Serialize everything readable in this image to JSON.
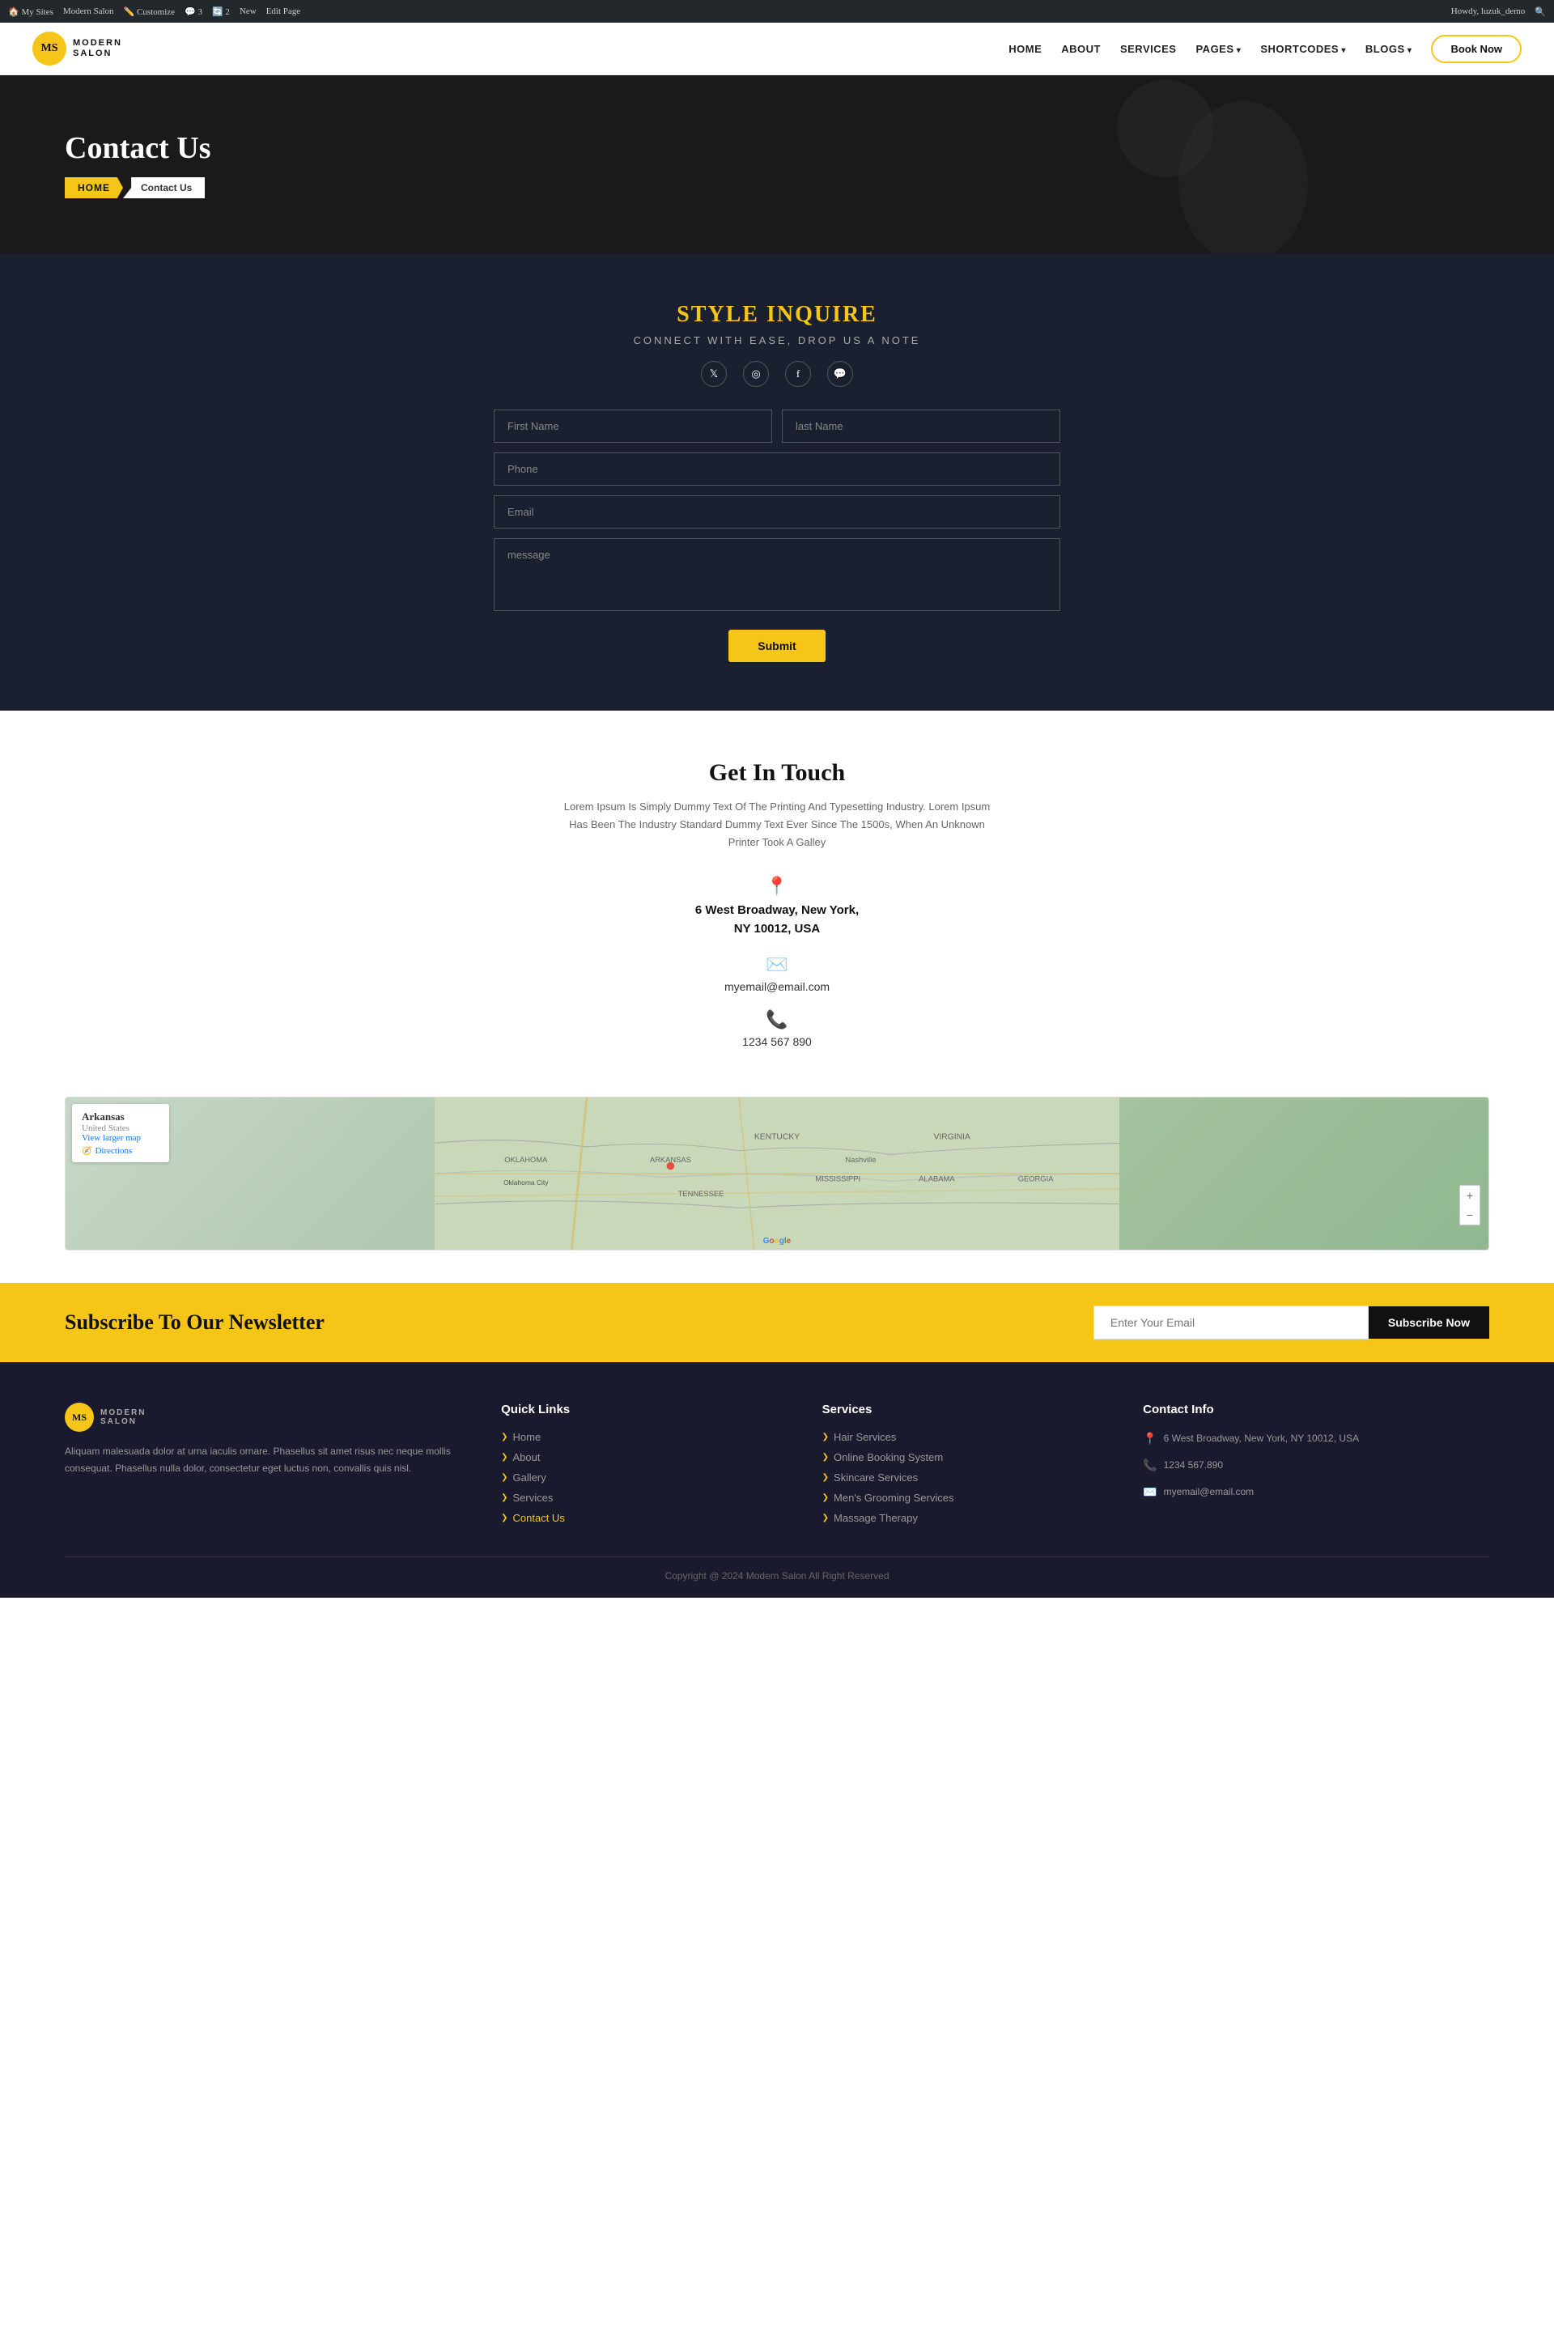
{
  "adminBar": {
    "left": [
      "My Sites",
      "Modern Salon",
      "Customize",
      "3",
      "2",
      "New",
      "Edit Page"
    ],
    "right": [
      "Howdy, luzuk_demo",
      "🔍"
    ]
  },
  "header": {
    "logoInitials": "MS",
    "logoName": "MODERN",
    "logoTagline": "SALON",
    "nav": [
      {
        "label": "HOME",
        "href": "#"
      },
      {
        "label": "ABOUT",
        "href": "#"
      },
      {
        "label": "SERVICES",
        "href": "#"
      },
      {
        "label": "PAGES",
        "href": "#",
        "dropdown": true
      },
      {
        "label": "SHORTCODES",
        "href": "#",
        "dropdown": true
      },
      {
        "label": "BLOGS",
        "href": "#",
        "dropdown": true
      }
    ],
    "bookBtn": "Book Now"
  },
  "hero": {
    "title": "Contact Us",
    "breadcrumbHome": "HOME",
    "breadcrumbCurrent": "Contact Us"
  },
  "contactForm": {
    "sectionTitle": "STYLE INQUIRE",
    "sectionSubtitle": "CONNECT WITH EASE, DROP US A NOTE",
    "socialIcons": [
      "𝕏",
      "📷",
      "f",
      "💬"
    ],
    "fields": {
      "firstName": "First Name",
      "lastName": "last Name",
      "phone": "Phone",
      "email": "Email",
      "message": "message"
    },
    "submitBtn": "Submit"
  },
  "getInTouch": {
    "title": "Get In Touch",
    "description": "Lorem Ipsum Is Simply Dummy Text Of The Printing And Typesetting Industry. Lorem Ipsum Has Been The Industry Standard Dummy Text Ever Since The 1500s, When An Unknown Printer Took A Galley",
    "address": "6 West Broadway, New York,\nNY 10012, USA",
    "email": "myemail@email.com",
    "phone": "1234 567 890"
  },
  "map": {
    "stateName": "Arkansas",
    "countryName": "United States",
    "viewLarger": "View larger map",
    "directions": "Directions"
  },
  "newsletter": {
    "title": "Subscribe To Our Newsletter",
    "inputPlaceholder": "Enter Your Email",
    "btnLabel": "Subscribe Now"
  },
  "footer": {
    "logoInitials": "MS",
    "logoName": "MODERN",
    "logoTagline": "SALON",
    "description": "Aliquam malesuada dolor at urna iaculis ornare. Phasellus sit amet risus nec neque mollis consequat. Phasellus nulla dolor, consectetur eget luctus non, convallis quis nisl.",
    "quickLinks": {
      "title": "Quick Links",
      "items": [
        {
          "label": "Home",
          "href": "#",
          "active": false
        },
        {
          "label": "About",
          "href": "#",
          "active": false
        },
        {
          "label": "Gallery",
          "href": "#",
          "active": false
        },
        {
          "label": "Services",
          "href": "#",
          "active": false
        },
        {
          "label": "Contact Us",
          "href": "#",
          "active": true
        }
      ]
    },
    "services": {
      "title": "Services",
      "items": [
        {
          "label": "Hair Services"
        },
        {
          "label": "Online Booking System"
        },
        {
          "label": "Skincare Services"
        },
        {
          "label": "Men's Grooming Services"
        },
        {
          "label": "Massage Therapy"
        }
      ]
    },
    "contactInfo": {
      "title": "Contact Info",
      "address": "6 West Broadway, New York, NY 10012, USA",
      "phone": "1234 567.890",
      "email": "myemail@email.com"
    },
    "copyright": "Copyright @ 2024 Modern Salon All Right Reserved"
  }
}
